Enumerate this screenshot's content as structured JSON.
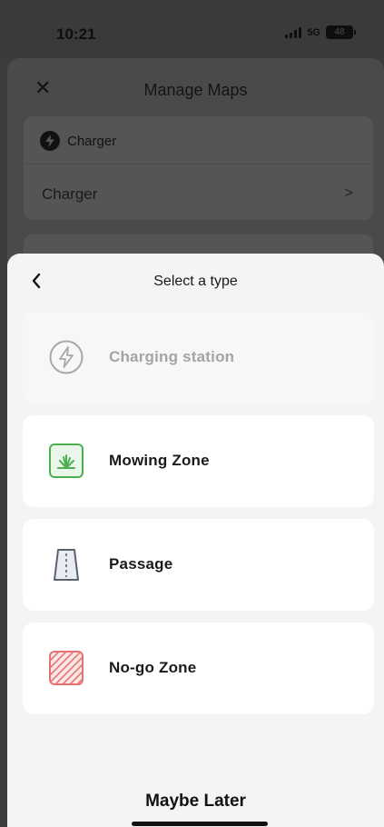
{
  "status_bar": {
    "time": "10:21",
    "network": "5G",
    "battery": "48"
  },
  "background": {
    "title": "Manage Maps",
    "card": {
      "header": "Charger",
      "row": "Charger"
    }
  },
  "sheet": {
    "title": "Select a type",
    "options": [
      {
        "label": "Charging station",
        "icon": "charging-station-icon",
        "enabled": false
      },
      {
        "label": "Mowing Zone",
        "icon": "mowing-zone-icon",
        "enabled": true,
        "color": "#4caf50"
      },
      {
        "label": "Passage",
        "icon": "passage-icon",
        "enabled": true,
        "color": "#5a6270"
      },
      {
        "label": "No-go Zone",
        "icon": "no-go-zone-icon",
        "enabled": true,
        "color": "#e57373"
      }
    ],
    "maybe_later": "Maybe Later"
  }
}
